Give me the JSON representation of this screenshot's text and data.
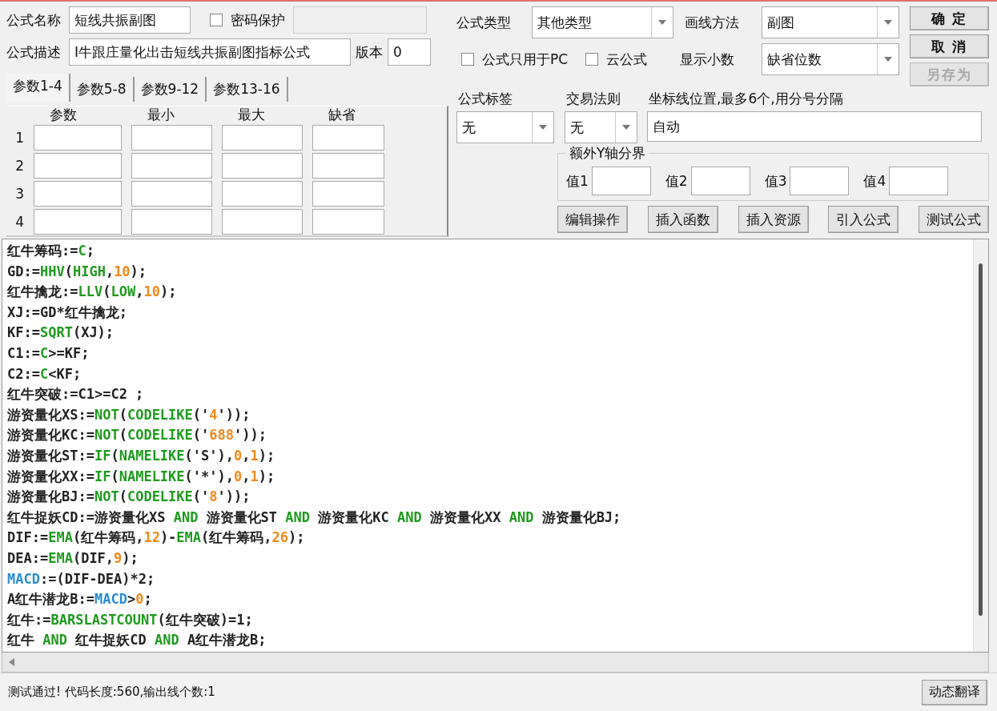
{
  "name": {
    "label": "公式名称",
    "value": "短线共振副图"
  },
  "password": {
    "label": "密码保护",
    "checked": false
  },
  "description": {
    "label": "公式描述",
    "value": "I牛跟庄量化出击短线共振副图指标公式"
  },
  "version": {
    "label": "版本",
    "value": "0"
  },
  "tabs": [
    {
      "label": "参数1-4",
      "selected": true
    },
    {
      "label": "参数5-8",
      "selected": false
    },
    {
      "label": "参数9-12",
      "selected": false
    },
    {
      "label": "参数13-16",
      "selected": false
    }
  ],
  "param_columns": [
    "参数",
    "最小",
    "最大",
    "缺省"
  ],
  "param_rows": [
    "1",
    "2",
    "3",
    "4"
  ],
  "formula_type": {
    "label": "公式类型",
    "value": "其他类型"
  },
  "draw_method": {
    "label": "画线方法",
    "value": "副图"
  },
  "options": [
    {
      "label": "公式只用于PC",
      "checked": false
    },
    {
      "label": "云公式",
      "checked": false
    }
  ],
  "decimals": {
    "label": "显示小数",
    "value": "缺省位数"
  },
  "buttons": [
    {
      "label": "确 定",
      "disabled": false
    },
    {
      "label": "取 消",
      "disabled": false
    },
    {
      "label": "另存为",
      "disabled": true
    }
  ],
  "formula_tag": {
    "label": "公式标签",
    "value": "无"
  },
  "trade_rule": {
    "label": "交易法则",
    "value": "无"
  },
  "axis_lines": {
    "label": "坐标线位置,最多6个,用分号分隔",
    "value": "自动"
  },
  "y_bounds": {
    "title": "额外Y轴分界",
    "fields": [
      "值1",
      "值2",
      "值3",
      "值4"
    ]
  },
  "tools": [
    "编辑操作",
    "插入函数",
    "插入资源",
    "引入公式",
    "测试公式"
  ],
  "code": [
    [
      {
        "kind": "text",
        "text": "红牛筹码:="
      },
      {
        "kind": "func",
        "text": "C"
      },
      {
        "kind": "text",
        "text": ";"
      }
    ],
    [
      {
        "kind": "text",
        "text": "GD:="
      },
      {
        "kind": "func",
        "text": "HHV"
      },
      {
        "kind": "text",
        "text": "("
      },
      {
        "kind": "func",
        "text": "HIGH"
      },
      {
        "kind": "text",
        "text": ","
      },
      {
        "kind": "num",
        "text": "10"
      },
      {
        "kind": "text",
        "text": ");"
      }
    ],
    [
      {
        "kind": "text",
        "text": "红牛擒龙:="
      },
      {
        "kind": "func",
        "text": "LLV"
      },
      {
        "kind": "text",
        "text": "("
      },
      {
        "kind": "func",
        "text": "LOW"
      },
      {
        "kind": "text",
        "text": ","
      },
      {
        "kind": "num",
        "text": "10"
      },
      {
        "kind": "text",
        "text": ");"
      }
    ],
    [
      {
        "kind": "text",
        "text": "XJ:=GD*红牛擒龙;"
      }
    ],
    [
      {
        "kind": "text",
        "text": "KF:="
      },
      {
        "kind": "func",
        "text": "SQRT"
      },
      {
        "kind": "text",
        "text": "(XJ);"
      }
    ],
    [
      {
        "kind": "text",
        "text": "C1:="
      },
      {
        "kind": "func",
        "text": "C"
      },
      {
        "kind": "text",
        "text": ">=KF;"
      }
    ],
    [
      {
        "kind": "text",
        "text": "C2:="
      },
      {
        "kind": "func",
        "text": "C"
      },
      {
        "kind": "text",
        "text": "<KF;"
      }
    ],
    [
      {
        "kind": "text",
        "text": "红牛突破:=C1>=C2 ;"
      }
    ],
    [
      {
        "kind": "text",
        "text": "游资量化XS:="
      },
      {
        "kind": "func",
        "text": "NOT"
      },
      {
        "kind": "text",
        "text": "("
      },
      {
        "kind": "func",
        "text": "CODELIKE"
      },
      {
        "kind": "text",
        "text": "('"
      },
      {
        "kind": "num",
        "text": "4"
      },
      {
        "kind": "text",
        "text": "'));"
      }
    ],
    [
      {
        "kind": "text",
        "text": "游资量化KC:="
      },
      {
        "kind": "func",
        "text": "NOT"
      },
      {
        "kind": "text",
        "text": "("
      },
      {
        "kind": "func",
        "text": "CODELIKE"
      },
      {
        "kind": "text",
        "text": "('"
      },
      {
        "kind": "num",
        "text": "688"
      },
      {
        "kind": "text",
        "text": "'));"
      }
    ],
    [
      {
        "kind": "text",
        "text": "游资量化ST:="
      },
      {
        "kind": "func",
        "text": "IF"
      },
      {
        "kind": "text",
        "text": "("
      },
      {
        "kind": "func",
        "text": "NAMELIKE"
      },
      {
        "kind": "text",
        "text": "('S'),"
      },
      {
        "kind": "num",
        "text": "0"
      },
      {
        "kind": "text",
        "text": ","
      },
      {
        "kind": "num",
        "text": "1"
      },
      {
        "kind": "text",
        "text": ");"
      }
    ],
    [
      {
        "kind": "text",
        "text": "游资量化XX:="
      },
      {
        "kind": "func",
        "text": "IF"
      },
      {
        "kind": "text",
        "text": "("
      },
      {
        "kind": "func",
        "text": "NAMELIKE"
      },
      {
        "kind": "text",
        "text": "('*'),"
      },
      {
        "kind": "num",
        "text": "0"
      },
      {
        "kind": "text",
        "text": ","
      },
      {
        "kind": "num",
        "text": "1"
      },
      {
        "kind": "text",
        "text": ");"
      }
    ],
    [
      {
        "kind": "text",
        "text": "游资量化BJ:="
      },
      {
        "kind": "func",
        "text": "NOT"
      },
      {
        "kind": "text",
        "text": "("
      },
      {
        "kind": "func",
        "text": "CODELIKE"
      },
      {
        "kind": "text",
        "text": "('"
      },
      {
        "kind": "num",
        "text": "8"
      },
      {
        "kind": "text",
        "text": "'));"
      }
    ],
    [
      {
        "kind": "text",
        "text": "红牛捉妖CD:=游资量化XS "
      },
      {
        "kind": "func",
        "text": "AND"
      },
      {
        "kind": "text",
        "text": " 游资量化ST "
      },
      {
        "kind": "func",
        "text": "AND"
      },
      {
        "kind": "text",
        "text": " 游资量化KC "
      },
      {
        "kind": "func",
        "text": "AND"
      },
      {
        "kind": "text",
        "text": " 游资量化XX "
      },
      {
        "kind": "func",
        "text": "AND"
      },
      {
        "kind": "text",
        "text": " 游资量化BJ;"
      }
    ],
    [
      {
        "kind": "text",
        "text": "DIF:="
      },
      {
        "kind": "func",
        "text": "EMA"
      },
      {
        "kind": "text",
        "text": "(红牛筹码,"
      },
      {
        "kind": "num",
        "text": "12"
      },
      {
        "kind": "text",
        "text": ")-"
      },
      {
        "kind": "func",
        "text": "EMA"
      },
      {
        "kind": "text",
        "text": "(红牛筹码,"
      },
      {
        "kind": "num",
        "text": "26"
      },
      {
        "kind": "text",
        "text": ");"
      }
    ],
    [
      {
        "kind": "text",
        "text": "DEA:="
      },
      {
        "kind": "func",
        "text": "EMA"
      },
      {
        "kind": "text",
        "text": "(DIF,"
      },
      {
        "kind": "num",
        "text": "9"
      },
      {
        "kind": "text",
        "text": ");"
      }
    ],
    [
      {
        "kind": "var",
        "text": "MACD"
      },
      {
        "kind": "text",
        "text": ":=(DIF-DEA)*2;"
      }
    ],
    [
      {
        "kind": "text",
        "text": "A红牛潜龙B:="
      },
      {
        "kind": "var",
        "text": "MACD"
      },
      {
        "kind": "text",
        "text": ">"
      },
      {
        "kind": "num",
        "text": "0"
      },
      {
        "kind": "text",
        "text": ";"
      }
    ],
    [
      {
        "kind": "text",
        "text": "红牛:="
      },
      {
        "kind": "func",
        "text": "BARSLASTCOUNT"
      },
      {
        "kind": "text",
        "text": "(红牛突破)=1;"
      }
    ],
    [
      {
        "kind": "text",
        "text": "红牛 "
      },
      {
        "kind": "func",
        "text": "AND"
      },
      {
        "kind": "text",
        "text": " 红牛捉妖CD "
      },
      {
        "kind": "func",
        "text": "AND"
      },
      {
        "kind": "text",
        "text": " A红牛潜龙B;"
      }
    ]
  ],
  "status": {
    "text": "测试通过! 代码长度:560,输出线个数:1",
    "button": "动态翻译"
  }
}
